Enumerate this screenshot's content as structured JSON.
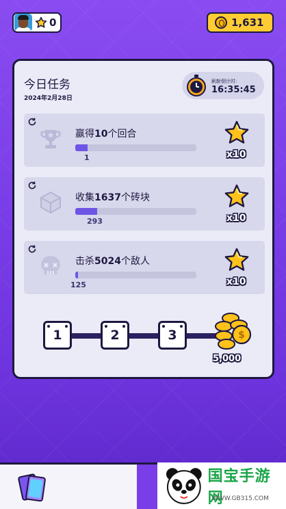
{
  "topbar": {
    "player_stars": "0",
    "coins": "1,631"
  },
  "panel": {
    "title": "今日任务",
    "date": "2024年2月28日",
    "timer_label": "刷新倒计时:",
    "timer_value": "16:35:45"
  },
  "tasks": [
    {
      "prefix": "赢得",
      "number": "10",
      "suffix": "个回合",
      "progress": "1",
      "target": 10,
      "current": 1,
      "reward": "x10",
      "icon": "trophy-icon"
    },
    {
      "prefix": "收集",
      "number": "1637",
      "suffix": "个砖块",
      "progress": "293",
      "target": 1637,
      "current": 293,
      "reward": "x10",
      "icon": "cube-icon"
    },
    {
      "prefix": "击杀",
      "number": "5024",
      "suffix": "个敌人",
      "progress": "125",
      "target": 5024,
      "current": 125,
      "reward": "x10",
      "icon": "skull-icon"
    }
  ],
  "milestones": [
    "1",
    "2",
    "3"
  ],
  "final_reward": "5,000",
  "watermark": {
    "name": "国宝手游网",
    "url": "WWW.GB315.COM"
  },
  "colors": {
    "background": "#7a3ee8",
    "panel": "#ebebf8",
    "progress": "#6e55e6",
    "coin": "#ffcc33",
    "outline": "#1d1840"
  }
}
